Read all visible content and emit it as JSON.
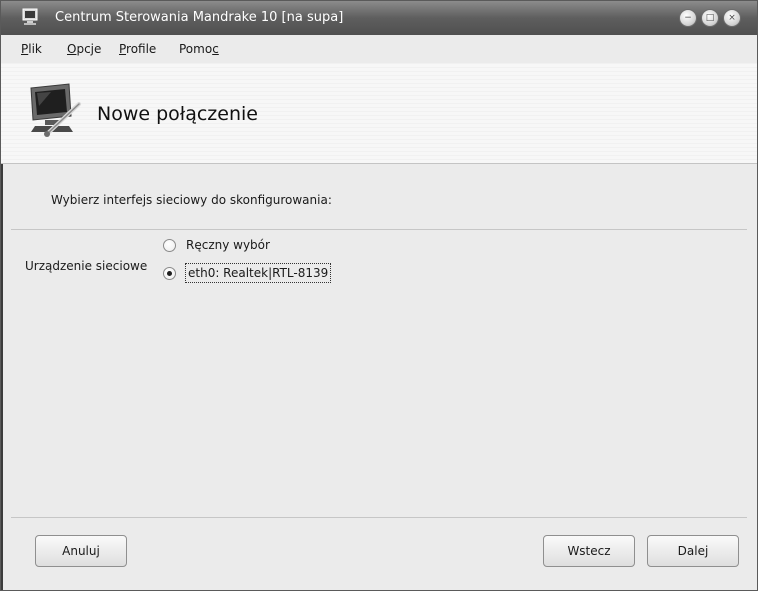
{
  "window": {
    "title": "Centrum Sterowania Mandrake 10 [na supa]"
  },
  "menubar": {
    "items": [
      {
        "pre": "",
        "ul": "P",
        "post": "lik"
      },
      {
        "pre": "",
        "ul": "O",
        "post": "pcje"
      },
      {
        "pre": "",
        "ul": "P",
        "post": "rofile"
      },
      {
        "pre": "Pomo",
        "ul": "c",
        "post": ""
      }
    ]
  },
  "banner": {
    "title": "Nowe połączenie"
  },
  "wizard": {
    "instruction": "Wybierz interfejs sieciowy do skonfigurowania:",
    "field_label": "Urządzenie sieciowe",
    "options": [
      {
        "label": "Ręczny wybór",
        "selected": false
      },
      {
        "label": "eth0: Realtek|RTL-8139",
        "selected": true
      }
    ]
  },
  "buttons": {
    "cancel": "Anuluj",
    "back": "Wstecz",
    "next": "Dalej"
  }
}
